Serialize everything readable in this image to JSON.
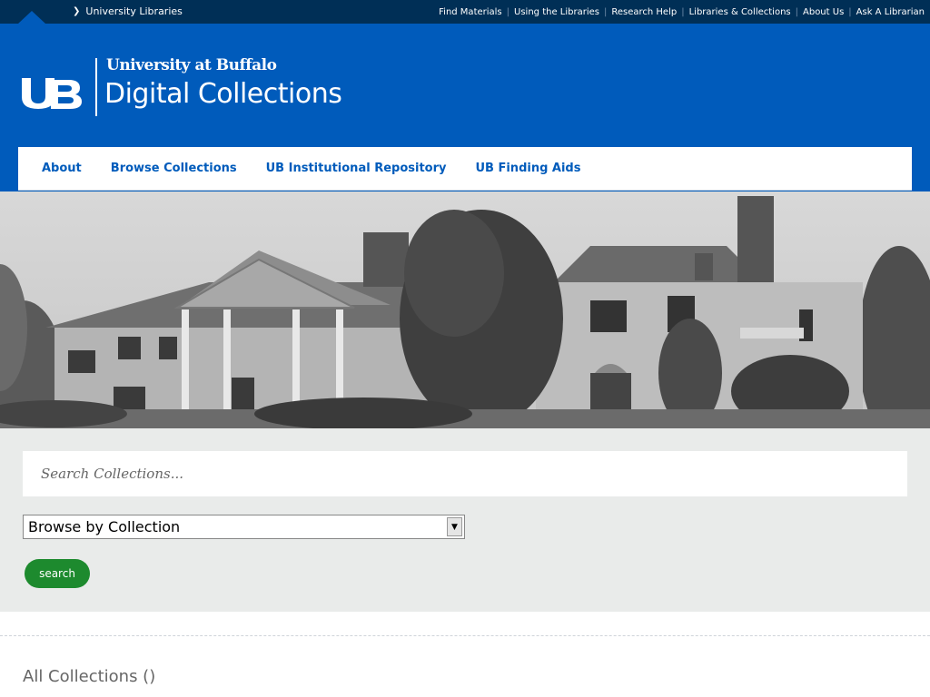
{
  "topbar": {
    "library_link": "University Libraries",
    "links": [
      "Find Materials",
      "Using the Libraries",
      "Research Help",
      "Libraries & Collections",
      "About Us",
      "Ask A Librarian"
    ]
  },
  "header": {
    "logo_mark": "UB",
    "university": "University at Buffalo",
    "site_title": "Digital Collections"
  },
  "nav": {
    "items": [
      "About",
      "Browse Collections",
      "UB Institutional Repository",
      "UB Finding Aids"
    ]
  },
  "search": {
    "placeholder": "Search Collections...",
    "select_value": "Browse by Collection",
    "button_label": "search"
  },
  "collections": {
    "heading": "All Collections ()"
  },
  "colors": {
    "ub_blue": "#005bbb",
    "ub_dark_blue": "#002f56",
    "search_green": "#1d8a2e",
    "panel_gray": "#e9ebea"
  }
}
